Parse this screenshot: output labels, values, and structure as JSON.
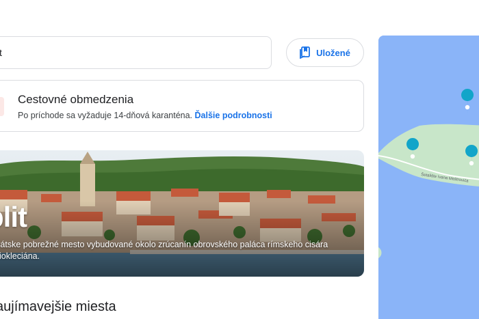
{
  "search": {
    "value": "plit"
  },
  "saved_button": {
    "label": "Uložené"
  },
  "travel_restrictions": {
    "title": "Cestovné obmedzenia",
    "text": "Po príchode sa vyžaduje 14-dňová karanténa.",
    "link": "Ďalšie podrobnosti"
  },
  "hero": {
    "title": "plit",
    "description": "rvátske pobrežné mesto vybudované okolo zrúcanín obrovského paláca rímskeho cisára Diokleciána."
  },
  "section": {
    "heading": "aujímavejšie miesta"
  },
  "map": {
    "street_label": "Šetalište Ivana Meštrovića"
  },
  "colors": {
    "accent": "#1a73e8",
    "map_water": "#8ab4f8",
    "map_land": "#c8e6c9",
    "pin": "#12a5c9"
  },
  "icons": {
    "saved": "bookmark-list-icon",
    "pin": "map-pin-icon"
  }
}
